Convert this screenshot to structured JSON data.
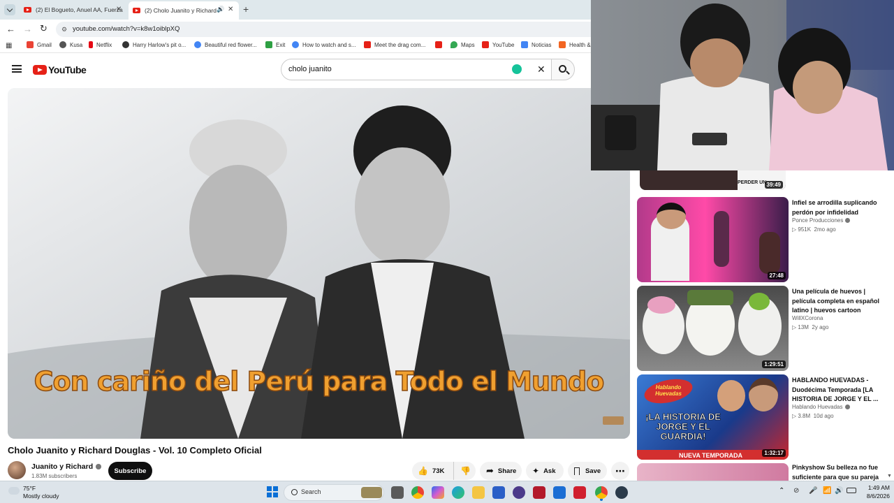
{
  "browser": {
    "tabs": [
      {
        "title": "(2) El Bogueto, Anuel AA, Fuerza"
      },
      {
        "title": "(2) Cholo Juanito y Richard"
      }
    ],
    "url": "youtube.com/watch?v=k8w1oiblpXQ",
    "bookmarks": [
      {
        "label": "Gmail",
        "color": "#ea4335"
      },
      {
        "label": "Kusa",
        "color": "#555555"
      },
      {
        "label": "Netflix",
        "color": "#e50914"
      },
      {
        "label": "Harry Harlow's pit o...",
        "color": "#333333"
      },
      {
        "label": "Beautiful red flower...",
        "color": "#4285f4"
      },
      {
        "label": "Exit",
        "color": "#2ea043"
      },
      {
        "label": "How to watch and s...",
        "color": "#4285f4"
      },
      {
        "label": "Meet the drag com...",
        "color": "#e62117"
      },
      {
        "label": "",
        "color": "#e62117"
      },
      {
        "label": "Maps",
        "color": "#34a853"
      },
      {
        "label": "YouTube",
        "color": "#e62117"
      },
      {
        "label": "Noticias",
        "color": "#4285f4"
      },
      {
        "label": "Health &",
        "color": "#f26522"
      }
    ]
  },
  "youtube": {
    "logo_text": "YouTube",
    "search_query": "cholo juanito",
    "video_overlay_text": "Con cariño del Perú para Todo el Mundo",
    "video_title": "Cholo Juanito y Richard Douglas - Vol. 10 Completo Oficial",
    "channel": {
      "name": "Juanito y Richard",
      "subscribers": "1.83M subscribers"
    },
    "subscribe_label": "Subscribe",
    "actions": {
      "likes": "73K",
      "share": "Share",
      "ask": "Ask",
      "save": "Save"
    },
    "recommendations": [
      {
        "title": "",
        "channel": "",
        "views": "",
        "age": "",
        "duration": "39:49",
        "thumb_text": "PERDER UN"
      },
      {
        "title": "Infiel se arrodilla suplicando perdón por infidelidad",
        "channel": "Ponce Producciones",
        "views": "951K",
        "age": "2mo ago",
        "duration": "27:48",
        "thumb_text": ""
      },
      {
        "title": "Una película de huevos | película completa en español latino | huevos cartoon",
        "channel": "WillXCorona",
        "views": "13M",
        "age": "2y ago",
        "duration": "1:29:51",
        "thumb_text": ""
      },
      {
        "title": "HABLANDO HUEVADAS - Duodécima Temporada [LA HISTORIA DE JORGE Y EL ...",
        "channel": "Hablando Huevadas",
        "views": "3.8M",
        "age": "10d ago",
        "duration": "1:32:17",
        "thumb_text": "¡LA HISTORIA DE JORGE Y EL GUARDIA!"
      },
      {
        "title": "Pinkyshow Su belleza no fue suficiente para que su pareja",
        "channel": "",
        "views": "",
        "age": "",
        "duration": "",
        "thumb_text": ""
      }
    ],
    "thumb4_banner": "NUEVA TEMPORADA",
    "thumb4_logo": "Hablando Huevadas"
  },
  "taskbar": {
    "weather": {
      "temp": "75°F",
      "condition": "Mostly cloudy"
    },
    "search_label": "Search",
    "time": "1:49 AM",
    "date": "8/6/2026"
  },
  "colors": {
    "accent": "#e62117",
    "tabstrip": "#dfe8ec",
    "taskbar": "#dde4ea"
  }
}
